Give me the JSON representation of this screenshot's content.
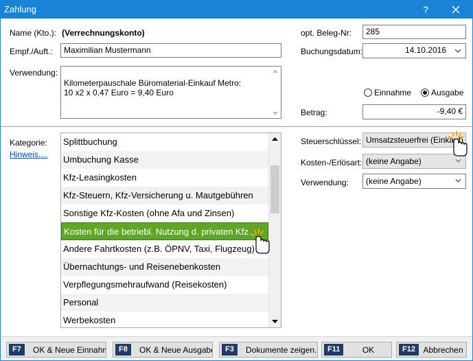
{
  "window": {
    "title": "Zahlung",
    "help_label": "?"
  },
  "form": {
    "name_label": "Name (Kto.):",
    "name_value": "(Verrechnungskonto)",
    "empf_label": "Empf./Auft.:",
    "empf_value": "Maximilian Mustermann",
    "verwendung_label": "Verwendung:",
    "verwendung_value": "Kilometerpauschale Büromaterial-Einkauf Metro:\n10 x2 x 0,47 Euro = 9,40 Euro",
    "beleg_label": "opt. Beleg-Nr:",
    "beleg_value": "285",
    "datum_label": "Buchungsdatum:",
    "datum_value": "14.10.2016",
    "einnahme_label": "Einnahme",
    "ausgabe_label": "Ausgabe",
    "betrag_label": "Betrag:",
    "betrag_value": "-9,40 €"
  },
  "category": {
    "label": "Kategorie:",
    "hint_link": "Hinweis....",
    "items": [
      "Splittbuchung",
      "Umbuchung Kasse",
      "Kfz-Leasingkosten",
      "Kfz-Steuern, Kfz-Versicherung u. Mautgebühren",
      "Sonstige Kfz-Kosten (ohne Afa und Zinsen)",
      "Kosten für die betriebl. Nutzung d. privaten Kfz",
      "Andere Fahrtkosten (z.B. ÖPNV, Taxi, Flugzeug)",
      "Übernachtungs- und Reisenebenkosten",
      "Verpflegungsmehraufwand (Reisekosten)",
      "Personal",
      "Werbekosten"
    ],
    "selected_index": 5
  },
  "tax": {
    "steuer_label": "Steuerschlüssel:",
    "steuer_value": "Umsatzsteuerfrei (Einkauf)",
    "kosten_label": "Kosten-/Erlösart:",
    "kosten_value": "(keine Angabe)",
    "verwendung_label": "Verwendung:",
    "verwendung_value": "(keine Angabe)"
  },
  "buttons": [
    {
      "key": "F7",
      "label": "OK & Neue Einnahme"
    },
    {
      "key": "F8",
      "label": "OK & Neue Ausgabe"
    },
    {
      "key": "F3",
      "label": "Dokumente zeigen..."
    },
    {
      "key": "F11",
      "label": "OK"
    },
    {
      "key": "F12",
      "label": "Abbrechen"
    }
  ],
  "colors": {
    "titlebar": "#1883d7",
    "selection": "#5ea624",
    "fkey": "#1f3b66"
  },
  "icons": [
    "close-icon",
    "chevron-down-icon",
    "scroll-up-icon",
    "scroll-down-icon",
    "hand-cursor-icon"
  ]
}
